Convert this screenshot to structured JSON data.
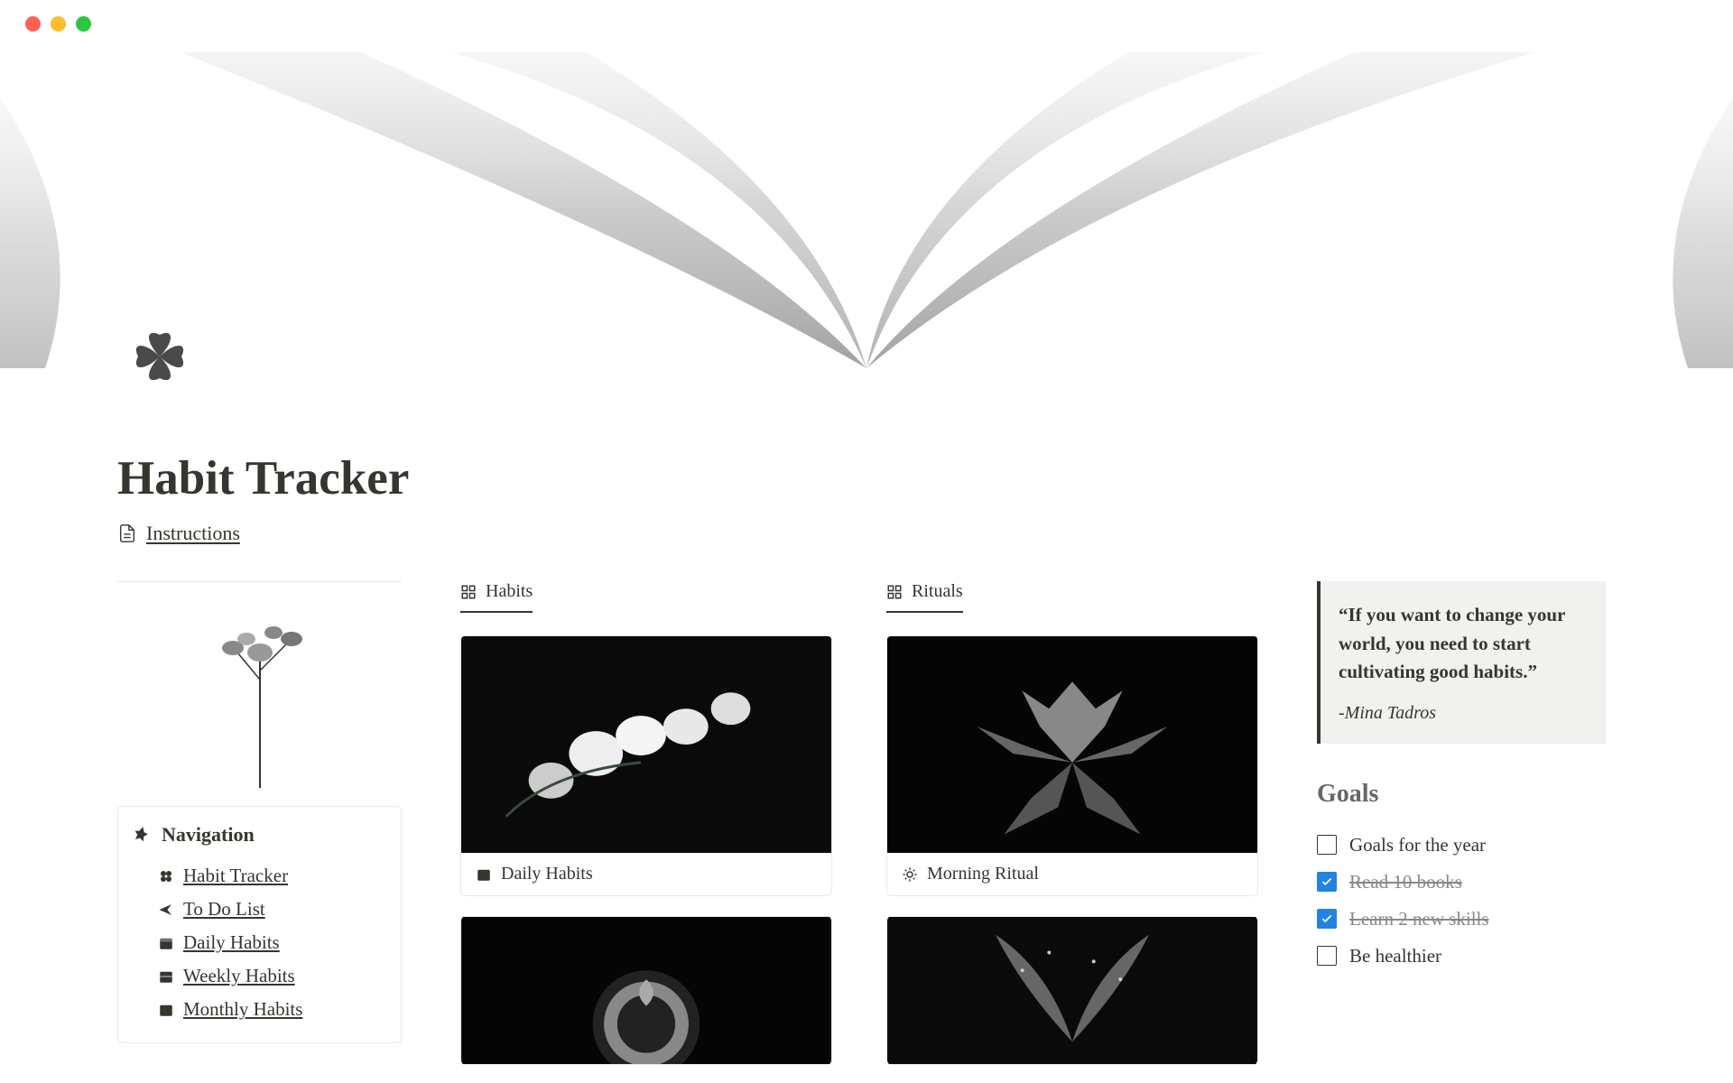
{
  "page": {
    "title": "Habit Tracker",
    "instructions_label": "Instructions"
  },
  "nav": {
    "heading": "Navigation",
    "items": [
      {
        "label": "Habit Tracker",
        "icon": "clover"
      },
      {
        "label": "To Do List",
        "icon": "arrow"
      },
      {
        "label": "Daily Habits",
        "icon": "cal-day"
      },
      {
        "label": "Weekly Habits",
        "icon": "cal-week"
      },
      {
        "label": "Monthly Habits",
        "icon": "cal-month"
      }
    ]
  },
  "habits_gallery": {
    "tab_label": "Habits",
    "card_title": "Daily Habits"
  },
  "rituals_gallery": {
    "tab_label": "Rituals",
    "card_title": "Morning Ritual"
  },
  "quote": {
    "text": "“If you want to change your world, you need to start cultivating good habits.”",
    "author": "-Mina Tadros"
  },
  "goals": {
    "heading": "Goals",
    "items": [
      {
        "label": "Goals for the year",
        "checked": false
      },
      {
        "label": "Read 10 books",
        "checked": true
      },
      {
        "label": "Learn 2 new skills",
        "checked": true
      },
      {
        "label": "Be healthier",
        "checked": false
      }
    ]
  }
}
